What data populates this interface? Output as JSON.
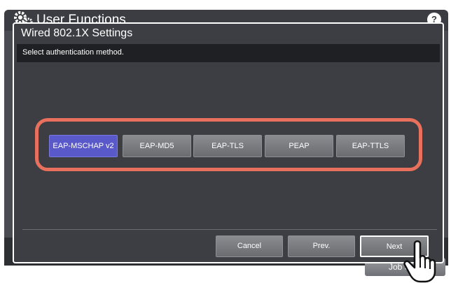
{
  "app": {
    "title": "User Functions",
    "help_label": "?",
    "job_button_label": "Job S"
  },
  "dialog": {
    "title": "Wired 802.1X Settings",
    "instruction": "Select authentication method."
  },
  "options": [
    {
      "label": "EAP-MSCHAP v2",
      "selected": true
    },
    {
      "label": "EAP-MD5",
      "selected": false
    },
    {
      "label": "EAP-TLS",
      "selected": false
    },
    {
      "label": "PEAP",
      "selected": false
    },
    {
      "label": "EAP-TTLS",
      "selected": false
    }
  ],
  "footer": {
    "cancel_label": "Cancel",
    "prev_label": "Prev.",
    "next_label": "Next"
  },
  "colors": {
    "highlight_outline": "#e8705c",
    "selected_option": "#5a59c9"
  },
  "icons": {
    "app_icon": "gear-icon",
    "pointer": "pointing-hand-icon"
  }
}
